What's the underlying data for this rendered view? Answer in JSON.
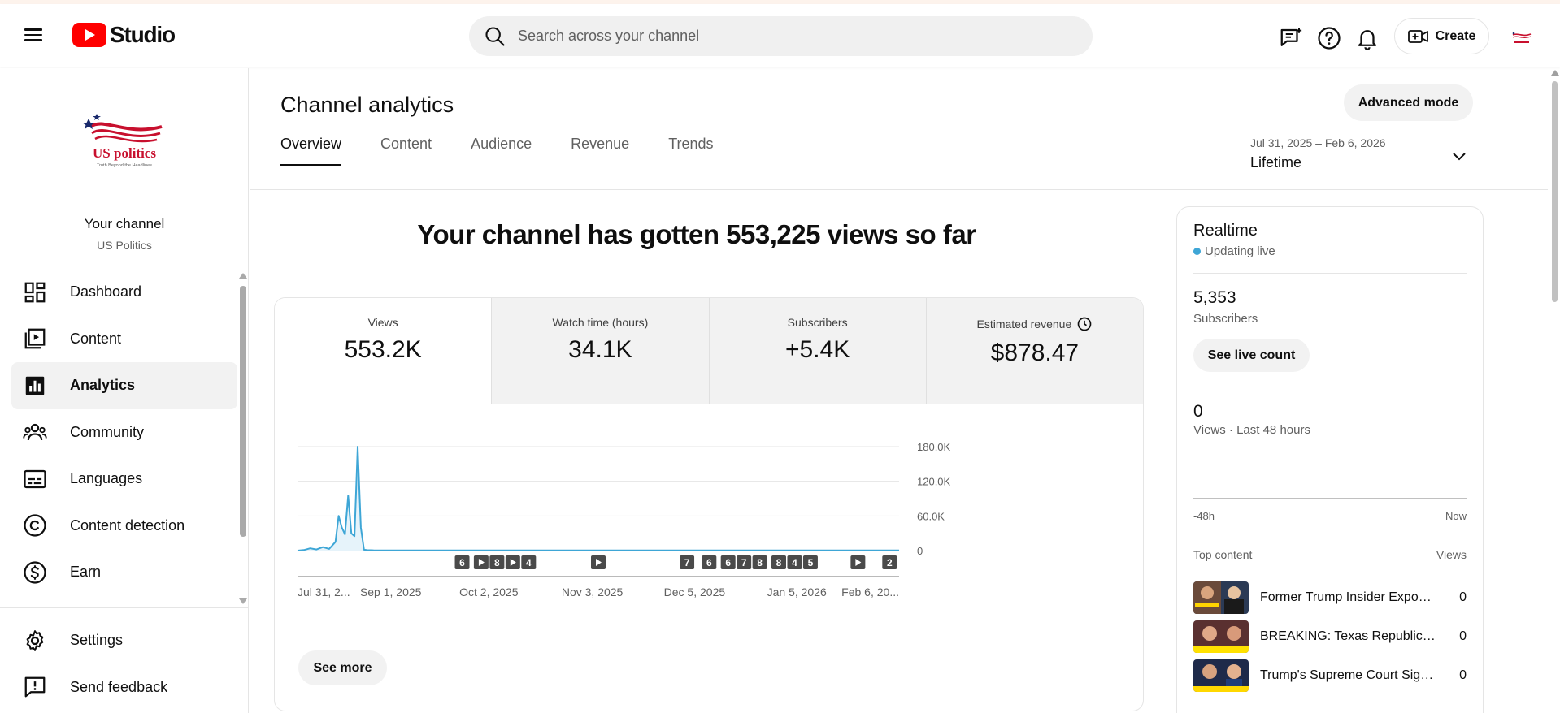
{
  "header": {
    "logo_text": "Studio",
    "search_placeholder": "Search across your channel",
    "create_label": "Create",
    "icons": [
      "hamburger-menu-icon",
      "search-icon",
      "feedback-message-icon",
      "help-icon",
      "notifications-bell-icon",
      "create-video-icon",
      "account-avatar"
    ]
  },
  "sidebar": {
    "channel_logo_text": "US politics",
    "channel_logo_tagline": "Truth Beyond the Headlines",
    "channel_title": "Your channel",
    "channel_name": "US Politics",
    "items": [
      {
        "label": "Dashboard",
        "icon": "dashboard-icon",
        "active": false
      },
      {
        "label": "Content",
        "icon": "content-icon",
        "active": false
      },
      {
        "label": "Analytics",
        "icon": "analytics-icon",
        "active": true
      },
      {
        "label": "Community",
        "icon": "community-icon",
        "active": false
      },
      {
        "label": "Languages",
        "icon": "languages-icon",
        "active": false
      },
      {
        "label": "Content detection",
        "icon": "copyright-icon",
        "active": false
      },
      {
        "label": "Earn",
        "icon": "dollar-icon",
        "active": false
      }
    ],
    "bottom_items": [
      {
        "label": "Settings",
        "icon": "gear-icon"
      },
      {
        "label": "Send feedback",
        "icon": "feedback-icon"
      }
    ]
  },
  "main": {
    "title": "Channel analytics",
    "advanced_mode_label": "Advanced mode",
    "tabs": [
      {
        "label": "Overview",
        "active": true
      },
      {
        "label": "Content",
        "active": false
      },
      {
        "label": "Audience",
        "active": false
      },
      {
        "label": "Revenue",
        "active": false
      },
      {
        "label": "Trends",
        "active": false
      }
    ],
    "date_range": "Jul 31, 2025 – Feb 6, 2026",
    "date_preset": "Lifetime",
    "headline": "Your channel has gotten 553,225 views so far",
    "metrics": [
      {
        "label": "Views",
        "value": "553.2K"
      },
      {
        "label": "Watch time (hours)",
        "value": "34.1K"
      },
      {
        "label": "Subscribers",
        "value": "+5.4K"
      },
      {
        "label": "Estimated revenue",
        "value": "$878.47",
        "icon": "clock-icon"
      }
    ],
    "see_more_label": "See more"
  },
  "chart_data": {
    "type": "area",
    "title": "",
    "xlabel": "",
    "ylabel": "",
    "y_ticks": [
      "180.0K",
      "120.0K",
      "60.0K",
      "0"
    ],
    "ylim": [
      0,
      180000
    ],
    "x_tick_labels": [
      "Jul 31, 2...",
      "Sep 1, 2025",
      "Oct 2, 2025",
      "Nov 3, 2025",
      "Dec 5, 2025",
      "Jan 5, 2026",
      "Feb 6, 20..."
    ],
    "series": [
      {
        "color": "#3ea6d6",
        "x": [
          "2025-07-31",
          "2025-08-02",
          "2025-08-04",
          "2025-08-06",
          "2025-08-08",
          "2025-08-10",
          "2025-08-12",
          "2025-08-13",
          "2025-08-14",
          "2025-08-15",
          "2025-08-16",
          "2025-08-17",
          "2025-08-18",
          "2025-08-19",
          "2025-08-20",
          "2025-08-21",
          "2025-08-22",
          "2025-08-24",
          "2025-09-01",
          "2025-10-01",
          "2025-11-01",
          "2025-12-01",
          "2026-01-01",
          "2026-02-06"
        ],
        "values": [
          0,
          1000,
          4000,
          2000,
          6000,
          3000,
          15000,
          60000,
          40000,
          28000,
          95000,
          30000,
          25000,
          180000,
          40000,
          1500,
          800,
          500,
          400,
          300,
          300,
          300,
          300,
          300
        ]
      }
    ],
    "video_markers": [
      {
        "date": "2025-09-21",
        "label": "6"
      },
      {
        "date": "2025-09-27",
        "label": "play"
      },
      {
        "date": "2025-10-02",
        "label": "8"
      },
      {
        "date": "2025-10-07",
        "label": "play"
      },
      {
        "date": "2025-10-12",
        "label": "4"
      },
      {
        "date": "2025-11-03",
        "label": "play"
      },
      {
        "date": "2025-12-01",
        "label": "7"
      },
      {
        "date": "2025-12-08",
        "label": "6"
      },
      {
        "date": "2025-12-14",
        "label": "6"
      },
      {
        "date": "2025-12-19",
        "label": "7"
      },
      {
        "date": "2025-12-24",
        "label": "8"
      },
      {
        "date": "2025-12-30",
        "label": "8"
      },
      {
        "date": "2026-01-04",
        "label": "4"
      },
      {
        "date": "2026-01-09",
        "label": "5"
      },
      {
        "date": "2026-01-24",
        "label": "play"
      },
      {
        "date": "2026-02-03",
        "label": "2"
      }
    ]
  },
  "realtime": {
    "title": "Realtime",
    "live_label": "Updating live",
    "subscribers_value": "5,353",
    "subscribers_label": "Subscribers",
    "live_count_button": "See live count",
    "views_value": "0",
    "views_label": "Views · Last 48 hours",
    "axis_left": "-48h",
    "axis_right": "Now",
    "top_content_label": "Top content",
    "views_col_label": "Views",
    "top_content": [
      {
        "title": "Former Trump Insider Exposes...",
        "views": "0"
      },
      {
        "title": "BREAKING: Texas Republican...",
        "views": "0"
      },
      {
        "title": "Trump's Supreme Court Signa...",
        "views": "0"
      }
    ]
  }
}
